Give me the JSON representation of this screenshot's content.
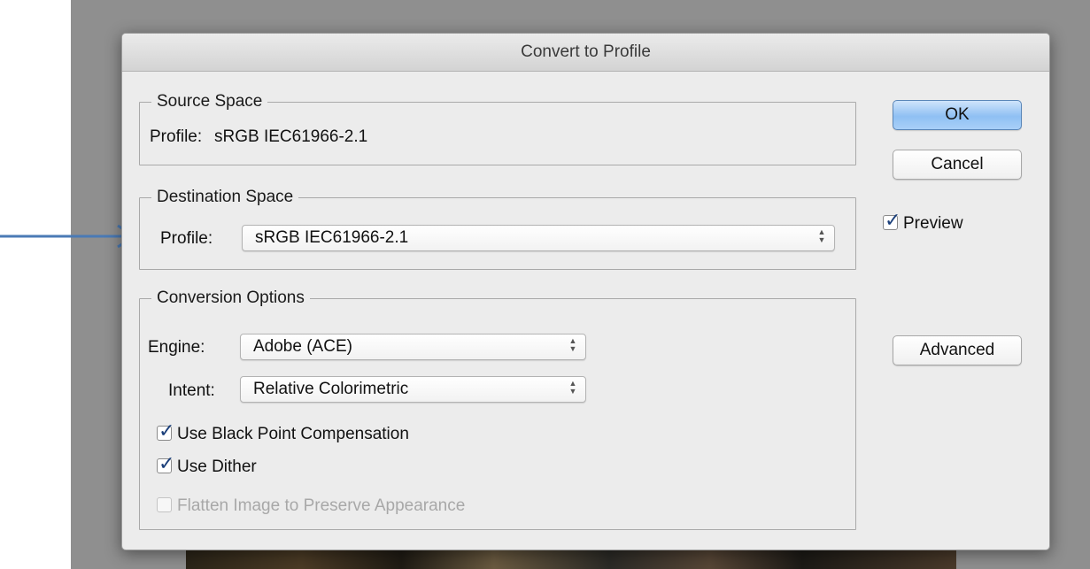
{
  "dialog": {
    "title": "Convert to Profile"
  },
  "source_space": {
    "legend": "Source Space",
    "profile_label": "Profile:",
    "profile_value": "sRGB IEC61966-2.1"
  },
  "destination_space": {
    "legend": "Destination Space",
    "profile_label": "Profile:",
    "profile_value": "sRGB IEC61966-2.1"
  },
  "conversion_options": {
    "legend": "Conversion Options",
    "engine_label": "Engine:",
    "engine_value": "Adobe (ACE)",
    "intent_label": "Intent:",
    "intent_value": "Relative Colorimetric",
    "black_point_label": "Use Black Point Compensation",
    "black_point_checked": true,
    "dither_label": "Use Dither",
    "dither_checked": true,
    "flatten_label": "Flatten Image to Preserve Appearance",
    "flatten_checked": false,
    "flatten_enabled": false
  },
  "buttons": {
    "ok": "OK",
    "cancel": "Cancel",
    "advanced": "Advanced"
  },
  "preview": {
    "label": "Preview",
    "checked": true
  },
  "colors": {
    "arrow": "#4a7ab5",
    "default_button": "#8fc0f3"
  }
}
